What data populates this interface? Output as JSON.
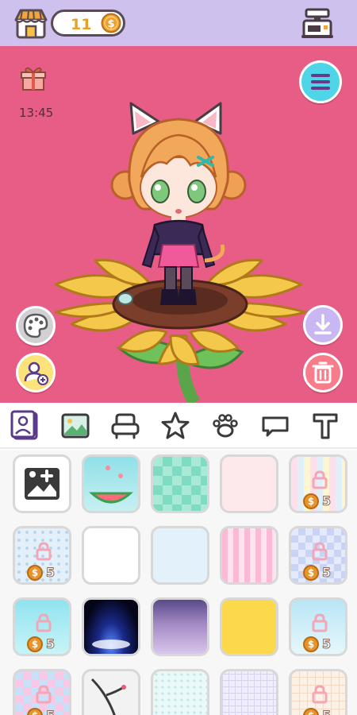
{
  "topbar": {
    "coins": "11",
    "shop_icon": "shop-icon",
    "coin_icon": "coin-icon",
    "coin_symbol": "$",
    "kiosk_icon": "kiosk-icon"
  },
  "stage": {
    "timer": "13:45",
    "gift_icon": "gift-icon",
    "menu_icon": "menu-icon",
    "palette_icon": "palette-icon",
    "add_avatar_icon": "add-person-icon",
    "download_icon": "download-icon",
    "trash_icon": "trash-icon",
    "background_color": "#e85d85"
  },
  "categories": [
    {
      "name": "background",
      "icon": "portrait-icon",
      "selected": true
    },
    {
      "name": "image",
      "icon": "image-icon",
      "selected": false
    },
    {
      "name": "furniture",
      "icon": "armchair-icon",
      "selected": false
    },
    {
      "name": "sticker",
      "icon": "star-icon",
      "selected": false
    },
    {
      "name": "pet",
      "icon": "paw-icon",
      "selected": false
    },
    {
      "name": "speech",
      "icon": "speech-bubble-icon",
      "selected": false
    },
    {
      "name": "text",
      "icon": "text-icon",
      "selected": false
    }
  ],
  "tiles": [
    {
      "kind": "add-photo",
      "locked": false
    },
    {
      "kind": "watermelon-sky",
      "locked": false
    },
    {
      "kind": "mint-check",
      "locked": false
    },
    {
      "kind": "pink-hearts",
      "locked": false
    },
    {
      "kind": "pastel-stripes",
      "locked": true,
      "price": "5"
    },
    {
      "kind": "blue-dots",
      "locked": true,
      "price": "5"
    },
    {
      "kind": "white-frame",
      "locked": false
    },
    {
      "kind": "light-blue",
      "locked": false
    },
    {
      "kind": "pink-stripes",
      "locked": false
    },
    {
      "kind": "blue-check",
      "locked": true,
      "price": "5"
    },
    {
      "kind": "cyan-sparkle",
      "locked": true,
      "price": "5"
    },
    {
      "kind": "night-stage",
      "locked": false
    },
    {
      "kind": "purple-curtain",
      "locked": false
    },
    {
      "kind": "yellow",
      "locked": false
    },
    {
      "kind": "sky-sparkle",
      "locked": true,
      "price": "5"
    },
    {
      "kind": "rainbow-check",
      "locked": true,
      "price": "5"
    },
    {
      "kind": "ink-branch",
      "locked": false
    },
    {
      "kind": "mint-dots",
      "locked": false
    },
    {
      "kind": "lavender-grid",
      "locked": false
    },
    {
      "kind": "cream-grid",
      "locked": true,
      "price": "5"
    }
  ]
}
